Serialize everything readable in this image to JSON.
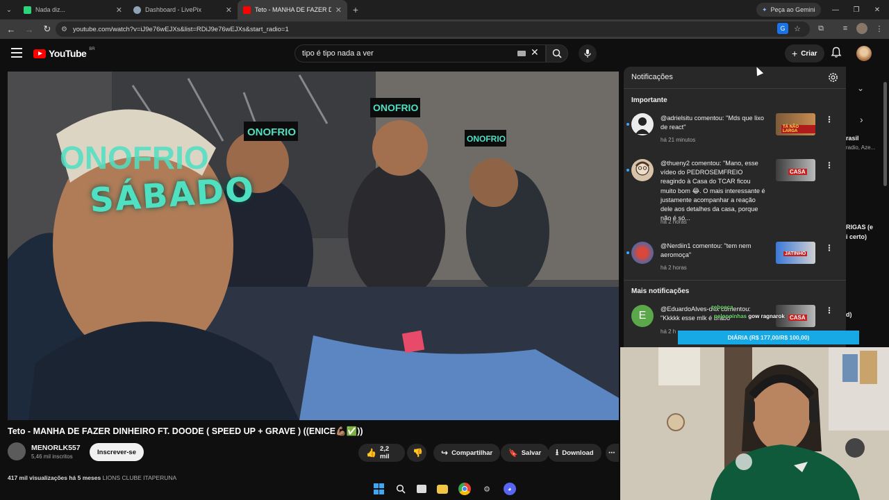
{
  "browser": {
    "tabs": [
      {
        "title": "Nada diz...",
        "fav_color": "#2bd67b",
        "active": false
      },
      {
        "title": "Dashboard - LivePix",
        "fav_color": "#8fa3b5",
        "active": false
      },
      {
        "title": "Teto - MANHA DE FAZER DI",
        "fav_color": "#ff0000",
        "active": true
      }
    ],
    "gemini_label": "Peça ao Gemini",
    "url": "youtube.com/watch?v=iJ9e76wEJXs&list=RDiJ9e76wEJXs&start_radio=1"
  },
  "youtube": {
    "logo_text": "YouTube",
    "country_code": "BR",
    "search_query": "tipo é tipo nada a ver",
    "create_label": "Criar"
  },
  "video": {
    "overlay_text": "SÁBADO",
    "title": "Teto - MANHA DE FAZER DINHEIRO FT. DOODE ( SPEED UP + GRAVE ) ((ENICE💪🏽✅))",
    "channel_name": "MENORLK557",
    "subscribers": "5,46 mil inscritos",
    "subscribe_label": "Inscrever-se",
    "likes": "2,2 mil",
    "share_label": "Compartilhar",
    "save_label": "Salvar",
    "download_label": "Download",
    "views_line": "417 mil visualizações  há 5 meses",
    "desc_channel": "LIONS CLUBE ITAPERUNA"
  },
  "notifications": {
    "title": "Notificações",
    "section_important": "Importante",
    "section_more": "Mais notificações",
    "items": [
      {
        "text": "@adrielsitu comentou: \"Mds que lixo de react\"",
        "time": "há 21 minutos",
        "thumb_label": "TÁ NÃO LARGA"
      },
      {
        "text": "@thueny2 comentou: \"Mano, esse vídeo do PEDROSEMFREIO reagindo à Casa do TCAR ficou muito bom 😂. O mais interessante é justamente acompanhar a reação dele aos detalhes da casa, porque não é só...",
        "time": "há 2 horas",
        "thumb_label": "CASA"
      },
      {
        "text": "@Nerdiin1 comentou: \"tem nem aeromoça\"",
        "time": "há 2 horas",
        "thumb_label": "JATINHO"
      },
      {
        "text": "@EduardoAlves-d4x comentou: \"Kkkkk esse mlk é brabo\"",
        "time": "há 2 h",
        "thumb_label": "CASA",
        "avatar_letter": "E"
      }
    ]
  },
  "sidebar_fragments": {
    "a": "rasil",
    "b": "radio, Aze...",
    "c": "RIGAS (e",
    "d": "i certo)",
    "e": "d)"
  },
  "stream_overlay": {
    "goal_text": "DIÁRIA (R$ 177,00/R$ 100,00)",
    "chat_user1": "pelonoinhas",
    "chat_msg1": "gow ragnarok",
    "chat_user2": "zeboeca"
  },
  "colors": {
    "accent_blue": "#3ea6ff",
    "yt_red": "#ff0000",
    "goal_bar": "#17a8e6",
    "overlay_teal": "#4fe0c2"
  }
}
